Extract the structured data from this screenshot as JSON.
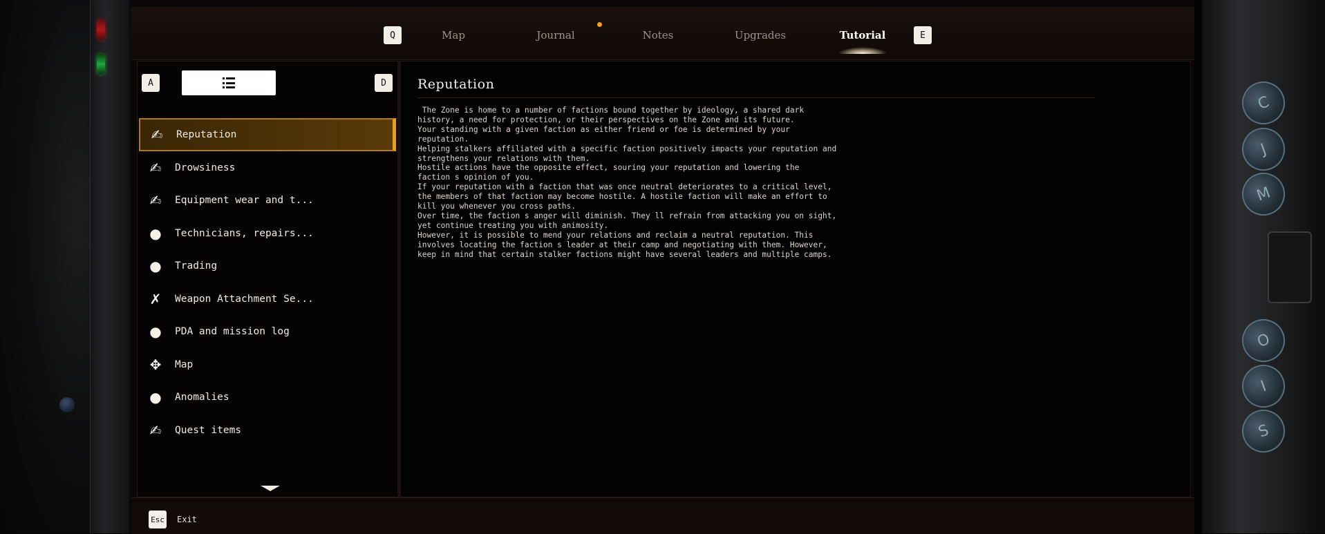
{
  "tabs": {
    "prev_key": "Q",
    "next_key": "E",
    "items": [
      {
        "label": "Map"
      },
      {
        "label": "Journal"
      },
      {
        "label": "Notes"
      },
      {
        "label": "Upgrades"
      },
      {
        "label": "Tutorial"
      }
    ],
    "active": "Tutorial"
  },
  "sidebar": {
    "prev_key": "A",
    "next_key": "D",
    "items": [
      {
        "label": "Reputation",
        "icon": "knife-icon"
      },
      {
        "label": "Drowsiness",
        "icon": "knife-icon"
      },
      {
        "label": "Equipment wear and t...",
        "icon": "knife-icon"
      },
      {
        "label": "Technicians, repairs...",
        "icon": "bag-icon"
      },
      {
        "label": "Trading",
        "icon": "bag-icon"
      },
      {
        "label": "Weapon Attachment Se...",
        "icon": "crossed-tools-icon"
      },
      {
        "label": "PDA and mission log",
        "icon": "bag-icon"
      },
      {
        "label": "Map",
        "icon": "move-arrows-icon"
      },
      {
        "label": "Anomalies",
        "icon": "bag-icon"
      },
      {
        "label": "Quest items",
        "icon": "knife-icon"
      }
    ],
    "selected": "Reputation"
  },
  "content": {
    "title": "Reputation",
    "body": " The Zone is home to a number of factions bound together by ideology, a shared dark\nhistory, a need for protection, or their perspectives on the Zone and its future.\nYour standing with a given faction as either friend or foe is determined by your\nreputation.\nHelping stalkers affiliated with a specific faction positively impacts your reputation and\nstrengthens your relations with them.\nHostile actions have the opposite effect, souring your reputation and lowering the\nfaction s opinion of you.\nIf your reputation with a faction that was once neutral deteriorates to a critical level,\nthe members of that faction may become hostile. A hostile faction will make an effort to\nkill you whenever you cross paths.\nOver time, the faction s anger will diminish. They ll refrain from attacking you on sight,\nyet continue treating you with animosity.\nHowever, it is possible to mend your relations and reclaim a neutral reputation. This\ninvolves locating the faction s leader at their camp and negotiating with them. However,\nkeep in mind that certain stalker factions might have several leaders and multiple camps."
  },
  "footer": {
    "exit_key": "Esc",
    "exit_label": "Exit"
  },
  "hardware_keys": [
    "C",
    "J",
    "M",
    "O",
    "I",
    "S"
  ],
  "colors": {
    "accent": "#e0a020",
    "notification": "#f2a31a"
  }
}
